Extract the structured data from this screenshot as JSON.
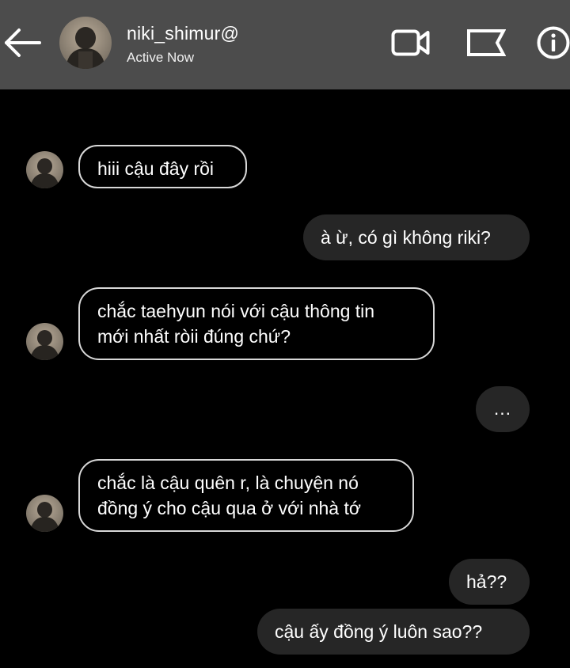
{
  "header": {
    "username": "niki_shimur@",
    "status": "Active Now"
  },
  "icons": {
    "back": "arrow-left-icon",
    "video": "video-camera-icon",
    "flag": "flag-icon",
    "info": "info-icon"
  },
  "messages": [
    {
      "from": "them",
      "text": "hiii cậu đây rồi"
    },
    {
      "from": "me",
      "text": "à ừ, có gì không riki?"
    },
    {
      "from": "them",
      "lines": [
        "chắc taehyun nói với cậu thông tin",
        "mới nhất ròii đúng chứ?"
      ]
    },
    {
      "from": "me",
      "text": "..."
    },
    {
      "from": "them",
      "lines": [
        "chắc là cậu quên r, là chuyện nó",
        "đồng ý cho cậu qua ở với nhà tớ"
      ]
    },
    {
      "from": "me",
      "text": "hả??"
    },
    {
      "from": "me",
      "text": "cậu ấy đồng ý luôn sao??"
    }
  ],
  "colors": {
    "header_bg": "#4c4c4c",
    "chat_bg": "#000000",
    "outgoing_bubble": "#262626",
    "incoming_border": "#d8d8d8"
  }
}
